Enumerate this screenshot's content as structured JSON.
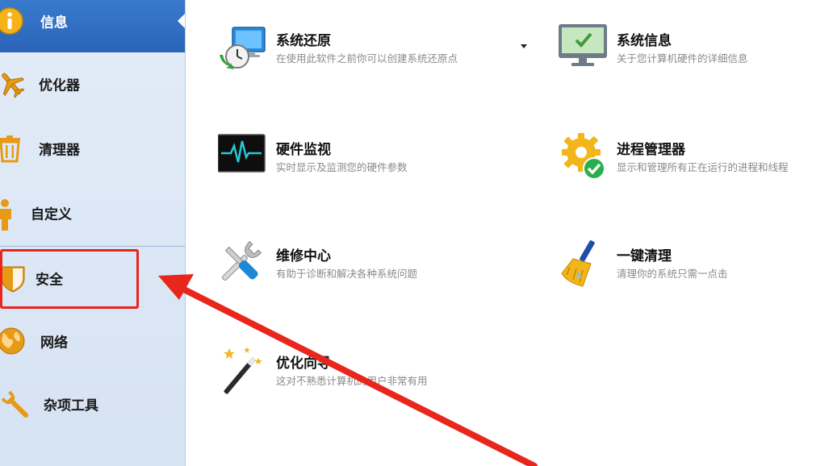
{
  "sidebar": {
    "items": [
      {
        "label": "信息",
        "icon": "info-icon"
      },
      {
        "label": "优化器",
        "icon": "airplane-icon"
      },
      {
        "label": "清理器",
        "icon": "trash-icon"
      },
      {
        "label": "自定义",
        "icon": "person-icon"
      },
      {
        "label": "安全",
        "icon": "shield-icon"
      },
      {
        "label": "网络",
        "icon": "globe-icon"
      },
      {
        "label": "杂项工具",
        "icon": "wrench-icon"
      }
    ]
  },
  "tools": [
    {
      "title": "系统还原",
      "desc": "在使用此软件之前你可以创建系统还原点",
      "icon": "system-restore-icon"
    },
    {
      "title": "系统信息",
      "desc": "关于您计算机硬件的详细信息",
      "icon": "monitor-check-icon"
    },
    {
      "title": "硬件监视",
      "desc": "实时显示及监测您的硬件参数",
      "icon": "pulse-monitor-icon"
    },
    {
      "title": "进程管理器",
      "desc": "显示和管理所有正在运行的进程和线程",
      "icon": "gear-check-icon"
    },
    {
      "title": "维修中心",
      "desc": "有助于诊断和解决各种系统问题",
      "icon": "tools-icon"
    },
    {
      "title": "一键清理",
      "desc": "清理你的系统只需一点击",
      "icon": "broom-icon"
    },
    {
      "title": "优化向导",
      "desc": "这对不熟悉计算机的用户非常有用",
      "icon": "magic-wand-icon"
    }
  ],
  "colors": {
    "active_nav": "#2f6fc6",
    "highlight": "#e8261c",
    "sidebar_bg": "#dde8f6"
  }
}
